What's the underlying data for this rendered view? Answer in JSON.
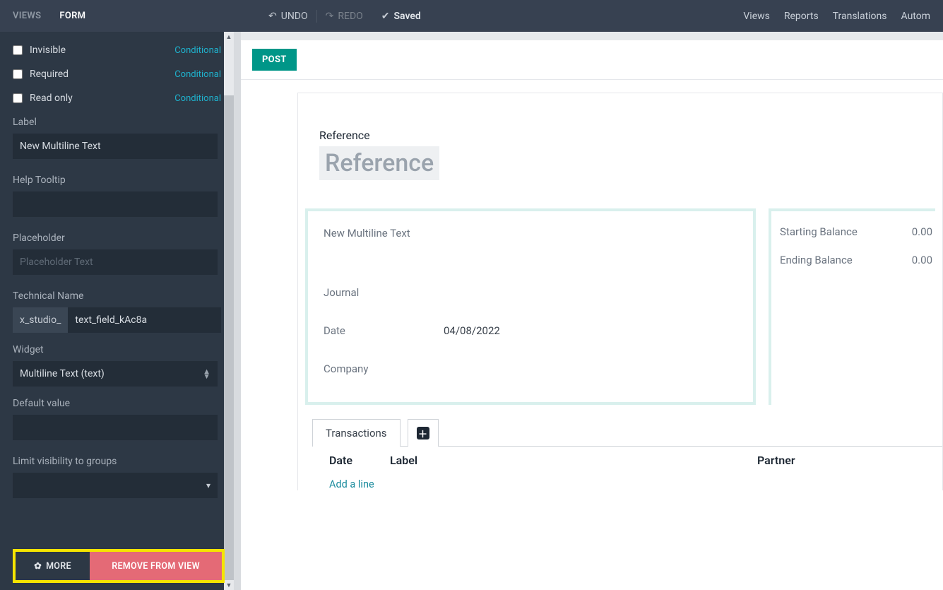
{
  "topbar": {
    "tabs": {
      "views": "VIEWS",
      "form": "FORM"
    },
    "undo": "UNDO",
    "redo": "REDO",
    "saved": "Saved",
    "right": {
      "views": "Views",
      "reports": "Reports",
      "translations": "Translations",
      "automations": "Autom"
    }
  },
  "sidebar": {
    "checks": {
      "invisible": "Invisible",
      "required": "Required",
      "readonly": "Read only",
      "conditional": "Conditional"
    },
    "label": {
      "title": "Label",
      "value": "New Multiline Text"
    },
    "help": {
      "title": "Help Tooltip",
      "value": ""
    },
    "placeholder": {
      "title": "Placeholder",
      "ph": "Placeholder Text",
      "value": ""
    },
    "tech": {
      "title": "Technical Name",
      "prefix": "x_studio_",
      "value": "text_field_kAc8a"
    },
    "widget": {
      "title": "Widget",
      "value": "Multiline Text (text)"
    },
    "default": {
      "title": "Default value",
      "value": ""
    },
    "groups": {
      "title": "Limit visibility to groups"
    },
    "buttons": {
      "more": "MORE",
      "remove": "REMOVE FROM VIEW"
    }
  },
  "preview": {
    "post": "POST",
    "reference_label": "Reference",
    "reference_value": "Reference",
    "form": {
      "newtext": "New Multiline Text",
      "journal_label": "Journal",
      "date_label": "Date",
      "date_value": "04/08/2022",
      "company_label": "Company",
      "start_bal_label": "Starting Balance",
      "start_bal_value": "0.00",
      "end_bal_label": "Ending Balance",
      "end_bal_value": "0.00"
    },
    "tabs": {
      "transactions": "Transactions"
    },
    "grid": {
      "date": "Date",
      "label": "Label",
      "partner": "Partner",
      "add_line": "Add a line"
    }
  }
}
